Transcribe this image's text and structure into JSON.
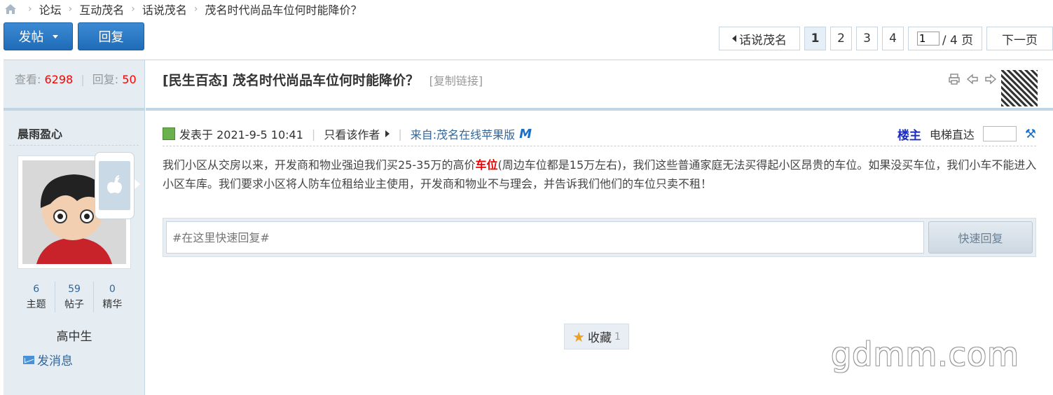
{
  "breadcrumb": {
    "items": [
      "论坛",
      "互动茂名",
      "话说茂名",
      "茂名时代尚品车位何时能降价？"
    ]
  },
  "toolbar": {
    "post_label": "发帖",
    "reply_label": "回复"
  },
  "pagination": {
    "back_label": "话说茂名",
    "pages": [
      "1",
      "2",
      "3",
      "4"
    ],
    "current_page": "1",
    "jump_value": "1",
    "total_label": "/ 4 页",
    "next_label": "下一页"
  },
  "thread": {
    "views_label": "查看:",
    "views": "6298",
    "replies_label": "回复:",
    "replies": "50",
    "category": "[民生百态]",
    "title": "茂名时代尚品车位何时能降价？",
    "copy_link": "[复制链接]"
  },
  "author": {
    "name": "晨雨盈心",
    "stats": [
      {
        "value": "6",
        "label": "主题"
      },
      {
        "value": "59",
        "label": "帖子"
      },
      {
        "value": "0",
        "label": "精华"
      }
    ],
    "rank": "高中生",
    "message_label": "发消息"
  },
  "post": {
    "posted_at": "发表于 2021-9-5 10:41",
    "only_author": "只看该作者",
    "source": "来自:茂名在线苹果版",
    "floor_label": "楼主",
    "elevator_label": "电梯直达",
    "body_before": "我们小区从交房以来，开发商和物业强迫我们买25-35万的高价",
    "body_highlight": "车位",
    "body_after": "(周边车位都是15万左右)，我们这些普通家庭无法买得起小区昂贵的车位。如果没买车位，我们小车不能进入小区车库。我们要求小区将人防车位租给业主使用，开发商和物业不与理会，并告诉我们他们的车位只卖不租！"
  },
  "quick_reply": {
    "placeholder": "#在这里快速回复#",
    "button_label": "快速回复"
  },
  "favorite": {
    "label": "收藏",
    "count": "1"
  },
  "watermark": "gdmm.com"
}
